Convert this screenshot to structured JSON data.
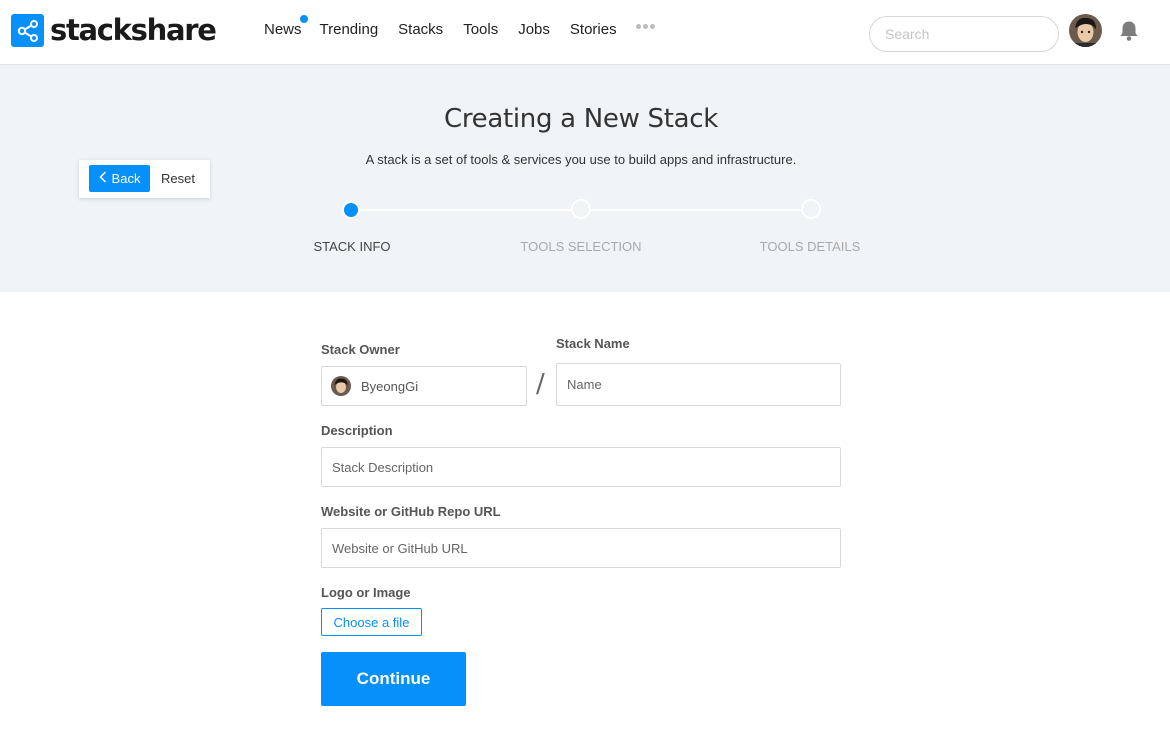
{
  "brand": {
    "name": "stackshare"
  },
  "nav": {
    "items": [
      {
        "label": "News",
        "has_dot": true
      },
      {
        "label": "Trending"
      },
      {
        "label": "Stacks"
      },
      {
        "label": "Tools"
      },
      {
        "label": "Jobs"
      },
      {
        "label": "Stories"
      }
    ]
  },
  "search": {
    "placeholder": "Search"
  },
  "hero": {
    "title": "Creating a New Stack",
    "subtitle": "A stack is a set of tools & services you use to build apps and infrastructure.",
    "back_label": "Back",
    "reset_label": "Reset",
    "steps": [
      {
        "label": "STACK INFO",
        "active": true
      },
      {
        "label": "TOOLS SELECTION",
        "active": false
      },
      {
        "label": "TOOLS DETAILS",
        "active": false
      }
    ]
  },
  "form": {
    "owner_label": "Stack Owner",
    "owner_value": "ByeongGi",
    "separator": "/",
    "name_label": "Stack Name",
    "name_placeholder": "Name",
    "description_label": "Description",
    "description_placeholder": "Stack Description",
    "url_label": "Website or GitHub Repo URL",
    "url_placeholder": "Website or GitHub URL",
    "logo_label": "Logo or Image",
    "file_button": "Choose a file",
    "continue_button": "Continue"
  },
  "colors": {
    "accent": "#0690fa",
    "hero_bg": "#f0f4f7",
    "text": "#333333"
  },
  "icons": {
    "logo": "share-nodes-icon",
    "more": "more-dots-icon",
    "bell": "bell-icon",
    "back": "chevron-left-icon"
  }
}
